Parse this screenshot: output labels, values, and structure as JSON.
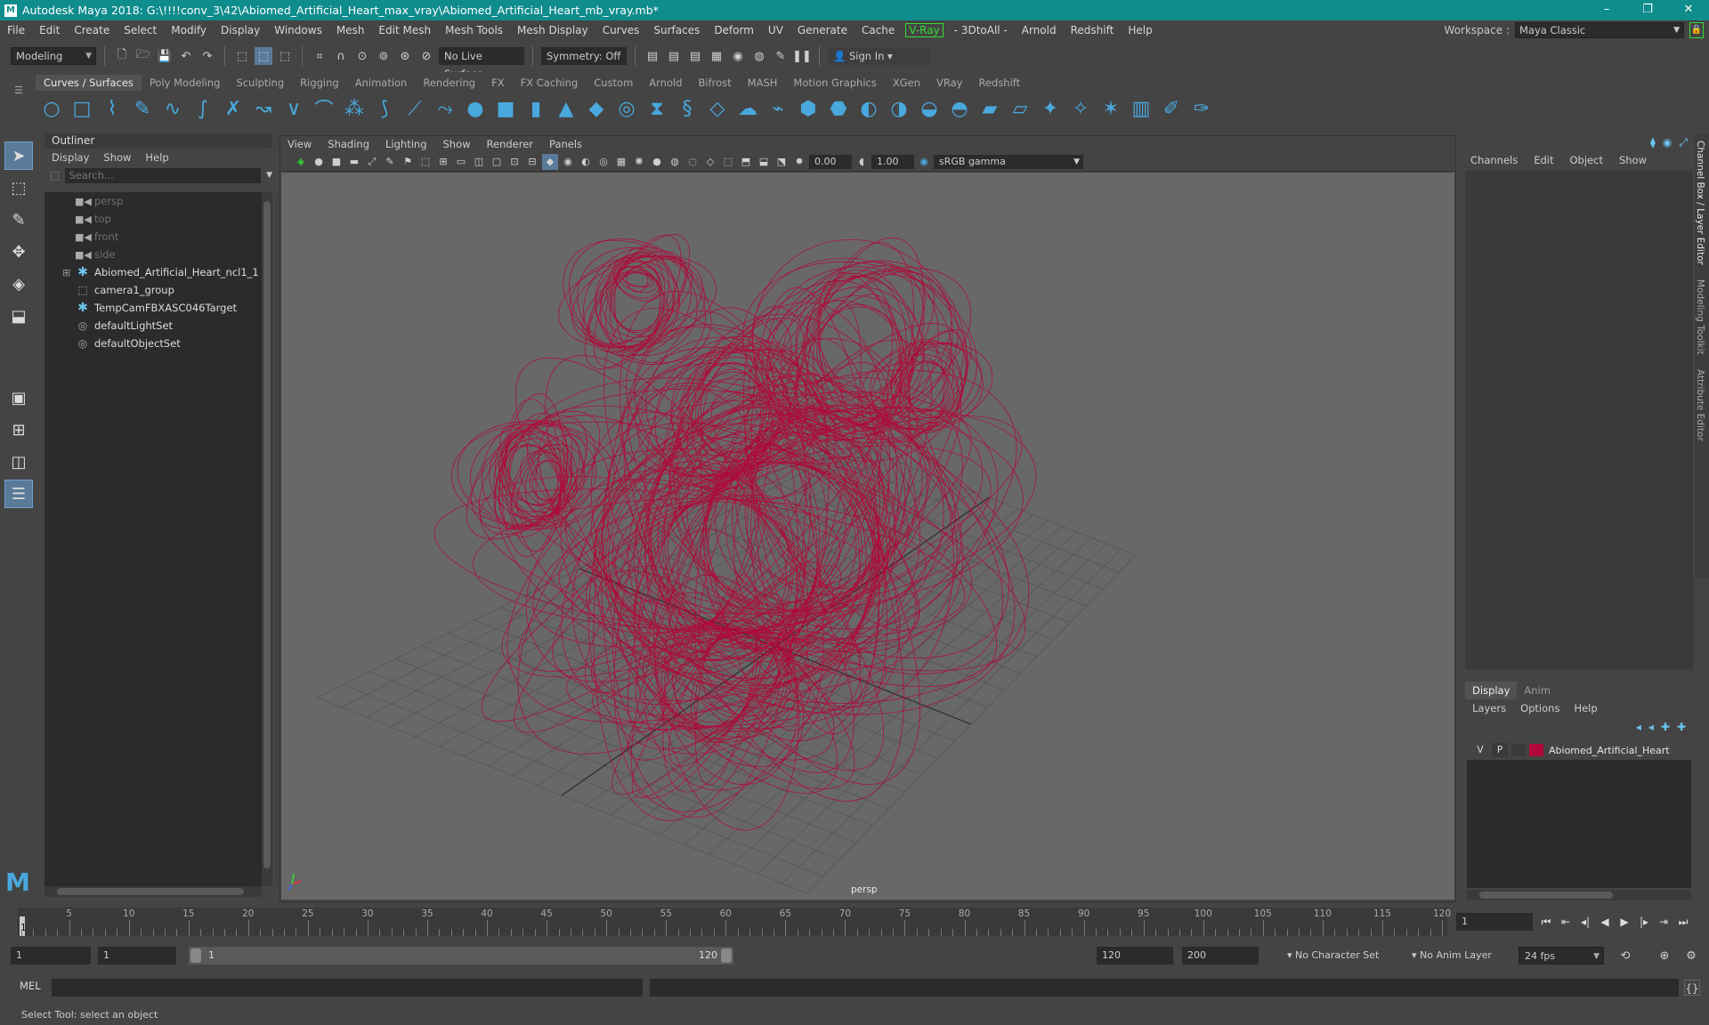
{
  "window": {
    "title": "Autodesk Maya 2018: G:\\!!!!conv_3\\42\\Abiomed_Artificial_Heart_max_vray\\Abiomed_Artificial_Heart_mb_vray.mb*",
    "app_icon": "M",
    "minimize": "–",
    "maximize": "❐",
    "close": "✕"
  },
  "menubar": {
    "items": [
      "File",
      "Edit",
      "Create",
      "Select",
      "Modify",
      "Display",
      "Windows",
      "Mesh",
      "Edit Mesh",
      "Mesh Tools",
      "Mesh Display",
      "Curves",
      "Surfaces",
      "Deform",
      "UV",
      "Generate",
      "Cache",
      "V-Ray",
      "- 3DtoAll -",
      "Arnold",
      "Redshift",
      "Help"
    ],
    "workspace_label": "Workspace :",
    "workspace_value": "Maya Classic"
  },
  "statusline": {
    "mode": "Modeling",
    "live_surface": "No Live Surface",
    "symmetry": "Symmetry: Off",
    "sign_in": "Sign In"
  },
  "shelf": {
    "tabs": [
      "Curves / Surfaces",
      "Poly Modeling",
      "Sculpting",
      "Rigging",
      "Animation",
      "Rendering",
      "FX",
      "FX Caching",
      "Custom",
      "Arnold",
      "Bifrost",
      "MASH",
      "Motion Graphics",
      "XGen",
      "VRay",
      "Redshift"
    ],
    "active_tab": "Curves / Surfaces"
  },
  "outliner": {
    "title": "Outliner",
    "menu": [
      "Display",
      "Show",
      "Help"
    ],
    "search_placeholder": "Search...",
    "items": [
      {
        "label": "persp",
        "dim": true,
        "icon": "camera-icon"
      },
      {
        "label": "top",
        "dim": true,
        "icon": "camera-icon"
      },
      {
        "label": "front",
        "dim": true,
        "icon": "camera-icon"
      },
      {
        "label": "side",
        "dim": true,
        "icon": "camera-icon"
      },
      {
        "label": "Abiomed_Artificial_Heart_ncl1_1",
        "dim": false,
        "icon": "transform-star-icon",
        "expandable": true
      },
      {
        "label": "camera1_group",
        "dim": false,
        "icon": "group-icon"
      },
      {
        "label": "TempCamFBXASC046Target",
        "dim": false,
        "icon": "transform-star-icon"
      },
      {
        "label": "defaultLightSet",
        "dim": false,
        "icon": "set-icon"
      },
      {
        "label": "defaultObjectSet",
        "dim": false,
        "icon": "set-icon"
      }
    ]
  },
  "viewport": {
    "menu": [
      "View",
      "Shading",
      "Lighting",
      "Show",
      "Renderer",
      "Panels"
    ],
    "exposure": "0.00",
    "gamma": "1.00",
    "color_space": "sRGB gamma",
    "camera_label": "persp",
    "wire_color": "#b0083a",
    "grid_color": "#555555"
  },
  "channel_box": {
    "menu": [
      "Channels",
      "Edit",
      "Object",
      "Show"
    ]
  },
  "side_tabs": [
    "Channel Box / Layer Editor",
    "Modeling Toolkit",
    "Attribute Editor"
  ],
  "layer_editor": {
    "tabs": [
      "Display",
      "Anim"
    ],
    "active_tab": "Display",
    "menu": [
      "Layers",
      "Options",
      "Help"
    ],
    "layers": [
      {
        "visible": "V",
        "playback": "P",
        "color": "#b0083a",
        "name": "Abiomed_Artificial_Heart"
      }
    ]
  },
  "timeslider": {
    "ticks": [
      5,
      10,
      15,
      20,
      25,
      30,
      35,
      40,
      45,
      50,
      55,
      60,
      65,
      70,
      75,
      80,
      85,
      90,
      95,
      100,
      105,
      110,
      115,
      120
    ],
    "range_start": 1,
    "range_end": 120,
    "current_frame": "1",
    "current_field": "1"
  },
  "rangeslider": {
    "start_field": "1",
    "start_field2": "1",
    "range_left": "1",
    "range_right": "120",
    "end_field": "120",
    "end_field2": "200",
    "character_set": "No Character Set",
    "anim_layer": "No Anim Layer",
    "fps": "24 fps"
  },
  "cmdline": {
    "lang": "MEL"
  },
  "helpline": {
    "text": "Select Tool: select an object"
  }
}
